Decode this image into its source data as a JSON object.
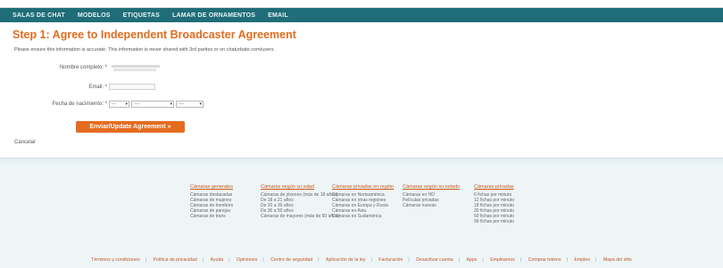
{
  "top": {
    "logo": "",
    "account": ""
  },
  "nav": {
    "items": [
      "SALAS DE CHAT",
      "MODELOS",
      "ETIQUETAS",
      "LAMAR DE ORNAMENTOS",
      "EMAIL"
    ]
  },
  "form": {
    "title": "Step 1: Agree to Independent Broadcaster Agreement",
    "intro": "Please ensure this information is accurate. This information is never shared with 3rd parties or on chaturbate.com/users",
    "labels": {
      "name": "Nombre completo: *",
      "email": "Email: *",
      "dob": "Fecha de nacimiento: *"
    },
    "email_value": "",
    "dob": {
      "day": "---",
      "month": "----",
      "year": "----"
    },
    "submit": "Enviar/Update Agreement  »",
    "cancel": "Cancelar"
  },
  "footer": {
    "columns": [
      {
        "title": "Cámaras generales",
        "links": [
          "Cámaras destacadas",
          "Cámaras de mujeres",
          "Cámaras de hombres",
          "Cámaras de parejas",
          "Cámaras de trans"
        ]
      },
      {
        "title": "Cámaras según su edad",
        "links": [
          "Cámaras de jóvenes (más de 18 años)",
          "De 18 a 21 años",
          "De 20 a 30 años",
          "De 30 a 50 años",
          "Cámaras de mayores (más de 50 años)"
        ]
      },
      {
        "title": "Cámaras privadas en región",
        "links": [
          "Cámaras en Norteamérica",
          "Cámaras en otras regiones",
          "Cámaras en Europa y Rusia",
          "Cámaras en Asia",
          "Cámaras en Sudamérica"
        ]
      },
      {
        "title": "Cámaras según su estado",
        "links": [
          "Cámaras en HD",
          "Películas privadas",
          "Cámaras nuevas"
        ]
      },
      {
        "title": "Cámaras privadas",
        "links": [
          "6 fichas por minuto",
          "12 fichas por minuto",
          "18 fichas por minuto",
          "30 fichas por minuto",
          "60 fichas por minuto",
          "90 fichas por minuto"
        ]
      }
    ],
    "links": [
      "Términos y condiciones",
      "Política de privacidad",
      "Ayuda",
      "Opiniones",
      "Centro de seguridad",
      "Aplicación de la ley",
      "Facturación",
      "Desactivar cuenta",
      "Apps",
      "Emplearnos",
      "Comprar tokens",
      "Empleo",
      "Mapa del sitio"
    ]
  }
}
